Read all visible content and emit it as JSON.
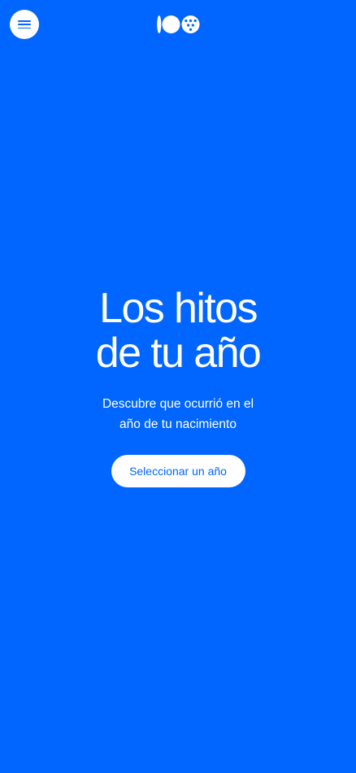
{
  "colors": {
    "background": "#0066ff",
    "text": "#ffffff",
    "button_background": "#ffffff",
    "button_text": "#0066ff"
  },
  "header": {
    "menu_icon": "hamburger-menu-icon",
    "logo_icon": "brand-logo-100"
  },
  "hero": {
    "title_line_1": "Los hitos",
    "title_line_2": "de tu año",
    "subtitle_line_1": "Descubre que ocurrió en el",
    "subtitle_line_2": "año de tu nacimiento",
    "button_label": "Seleccionar un año"
  }
}
